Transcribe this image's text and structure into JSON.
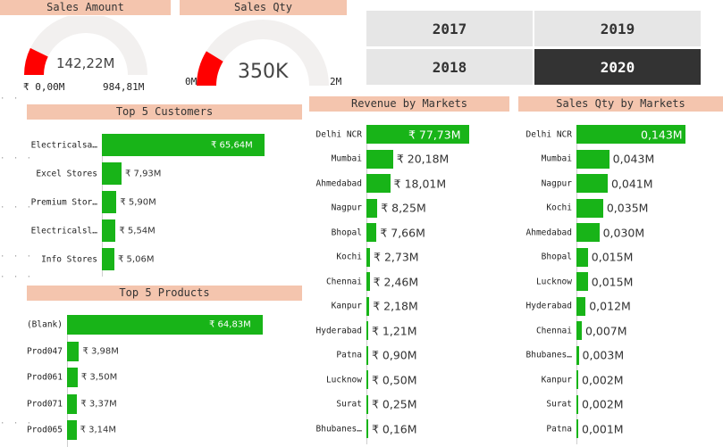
{
  "sales_amount": {
    "title": "Sales Amount",
    "value": "142,22M",
    "min": "₹ 0,00M",
    "max": "984,81M",
    "fill": 0.144
  },
  "sales_qty": {
    "title": "Sales Qty",
    "value": "350K",
    "min": "0M",
    "max": "2M",
    "fill": 0.175
  },
  "years": [
    {
      "label": "2017",
      "selected": false
    },
    {
      "label": "2019",
      "selected": false
    },
    {
      "label": "2018",
      "selected": false
    },
    {
      "label": "2020",
      "selected": true
    }
  ],
  "top_customers": {
    "title": "Top 5 Customers",
    "chart_data": {
      "type": "bar",
      "categories": [
        "Electricalsa…",
        "Excel Stores",
        "Premium Stor…",
        "Electricalsl…",
        "Info Stores"
      ],
      "values": [
        65.64,
        7.93,
        5.9,
        5.54,
        5.06
      ],
      "labels": [
        "₹ 65,64M",
        "₹ 7,93M",
        "₹ 5,90M",
        "₹ 5,54M",
        "₹ 5,06M"
      ]
    }
  },
  "top_products": {
    "title": "Top 5 Products",
    "chart_data": {
      "type": "bar",
      "categories": [
        "(Blank)",
        "Prod047",
        "Prod061",
        "Prod071",
        "Prod065"
      ],
      "values": [
        64.83,
        3.98,
        3.5,
        3.37,
        3.14
      ],
      "labels": [
        "₹ 64,83M",
        "₹ 3,98M",
        "₹ 3,50M",
        "₹ 3,37M",
        "₹ 3,14M"
      ]
    }
  },
  "revenue_markets": {
    "title": "Revenue by Markets",
    "chart_data": {
      "type": "bar",
      "categories": [
        "Delhi NCR",
        "Mumbai",
        "Ahmedabad",
        "Nagpur",
        "Bhopal",
        "Kochi",
        "Chennai",
        "Kanpur",
        "Hyderabad",
        "Patna",
        "Lucknow",
        "Surat",
        "Bhubanes…"
      ],
      "values": [
        77.73,
        20.18,
        18.01,
        8.25,
        7.66,
        2.73,
        2.46,
        2.18,
        1.21,
        0.9,
        0.5,
        0.25,
        0.16
      ],
      "labels": [
        "₹ 77,73M",
        "₹ 20,18M",
        "₹ 18,01M",
        "₹ 8,25M",
        "₹ 7,66M",
        "₹ 2,73M",
        "₹ 2,46M",
        "₹ 2,18M",
        "₹ 1,21M",
        "₹ 0,90M",
        "₹ 0,50M",
        "₹ 0,25M",
        "₹ 0,16M"
      ]
    }
  },
  "qty_markets": {
    "title": "Sales Qty by Markets",
    "chart_data": {
      "type": "bar",
      "categories": [
        "Delhi NCR",
        "Mumbai",
        "Nagpur",
        "Kochi",
        "Ahmedabad",
        "Bhopal",
        "Lucknow",
        "Hyderabad",
        "Chennai",
        "Bhubanes…",
        "Kanpur",
        "Surat",
        "Patna"
      ],
      "values": [
        0.143,
        0.043,
        0.041,
        0.035,
        0.03,
        0.015,
        0.015,
        0.012,
        0.007,
        0.003,
        0.002,
        0.002,
        0.001
      ],
      "labels": [
        "0,143M",
        "0,043M",
        "0,041M",
        "0,035M",
        "0,030M",
        "0,015M",
        "0,015M",
        "0,012M",
        "0,007M",
        "0,003M",
        "0,002M",
        "0,002M",
        "0,001M"
      ]
    }
  },
  "colors": {
    "bar": "#18b418",
    "gauge_fill": "#ff0000",
    "gauge_bg": "#f2f0ef",
    "header_bg": "#f4c5ae",
    "selected": "#333333"
  }
}
